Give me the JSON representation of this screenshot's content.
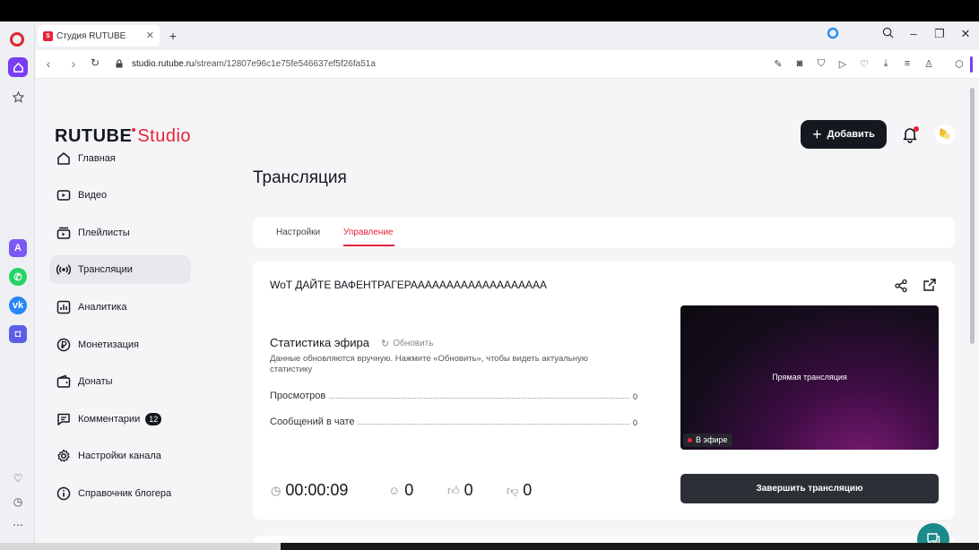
{
  "browser": {
    "tab_title": "Студия RUTUBE",
    "tab_close": "✕",
    "new_tab": "+",
    "url_host": "studio.rutube.ru",
    "url_path": "/stream/12807e96c1e75fe546637ef5f26fa51a"
  },
  "brand": {
    "logo_text": "RUTUBE",
    "logo_studio": "Studio",
    "accent": "#e6223a",
    "dark": "#14191f"
  },
  "header": {
    "add_label": "Добавить"
  },
  "sidebar": {
    "items": [
      {
        "label": "Главная",
        "icon": "home-icon"
      },
      {
        "label": "Видео",
        "icon": "video-icon"
      },
      {
        "label": "Плейлисты",
        "icon": "playlist-icon"
      },
      {
        "label": "Трансляции",
        "icon": "broadcast-icon"
      },
      {
        "label": "Аналитика",
        "icon": "chart-icon"
      },
      {
        "label": "Монетизация",
        "icon": "ruble-icon"
      },
      {
        "label": "Донаты",
        "icon": "wallet-icon"
      },
      {
        "label": "Комментарии",
        "icon": "comment-icon",
        "badge": "12"
      },
      {
        "label": "Настройки канала",
        "icon": "gear-icon"
      },
      {
        "label": "Справочник блогера",
        "icon": "info-icon"
      }
    ]
  },
  "main": {
    "title": "Трансляция",
    "tabs": [
      {
        "label": "Настройки"
      },
      {
        "label": "Управление"
      }
    ],
    "stream_title": "WoT ДАЙТЕ ВАФЕНТРАГЕРААААААААААААААААААА",
    "stats_title": "Статистика эфира",
    "refresh_label": "Обновить",
    "stats_note": "Данные обновляются вручную. Нажмите «Обновить», чтобы видеть актуальную статистику",
    "stats": [
      {
        "label": "Просмотров",
        "value": "0"
      },
      {
        "label": "Сообщений в чате",
        "value": "0"
      }
    ],
    "preview_label": "Прямая трансляция",
    "live_label": "В эфире",
    "end_label": "Завершить трансляцию",
    "metrics": {
      "duration": "00:00:09",
      "viewers": "0",
      "likes": "0",
      "dislikes": "0"
    }
  }
}
